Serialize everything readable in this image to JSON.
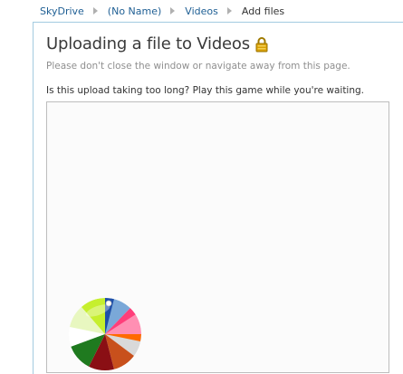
{
  "breadcrumb": {
    "items": [
      "SkyDrive",
      "(No Name)",
      "Videos"
    ],
    "current": "Add files"
  },
  "upload": {
    "title": "Uploading a file to Videos",
    "subtitle": "Please don't close the window or navigate away from this page.",
    "prompt": "Is this upload taking too long? Play this game while you're waiting."
  },
  "icons": {
    "lock": "lock-icon",
    "separator": "chevron-right-icon",
    "ball": "beach-ball-icon"
  },
  "colors": {
    "link": "#1f5f94",
    "panel_border": "#a3cbe0",
    "lock": "#d9a000"
  }
}
